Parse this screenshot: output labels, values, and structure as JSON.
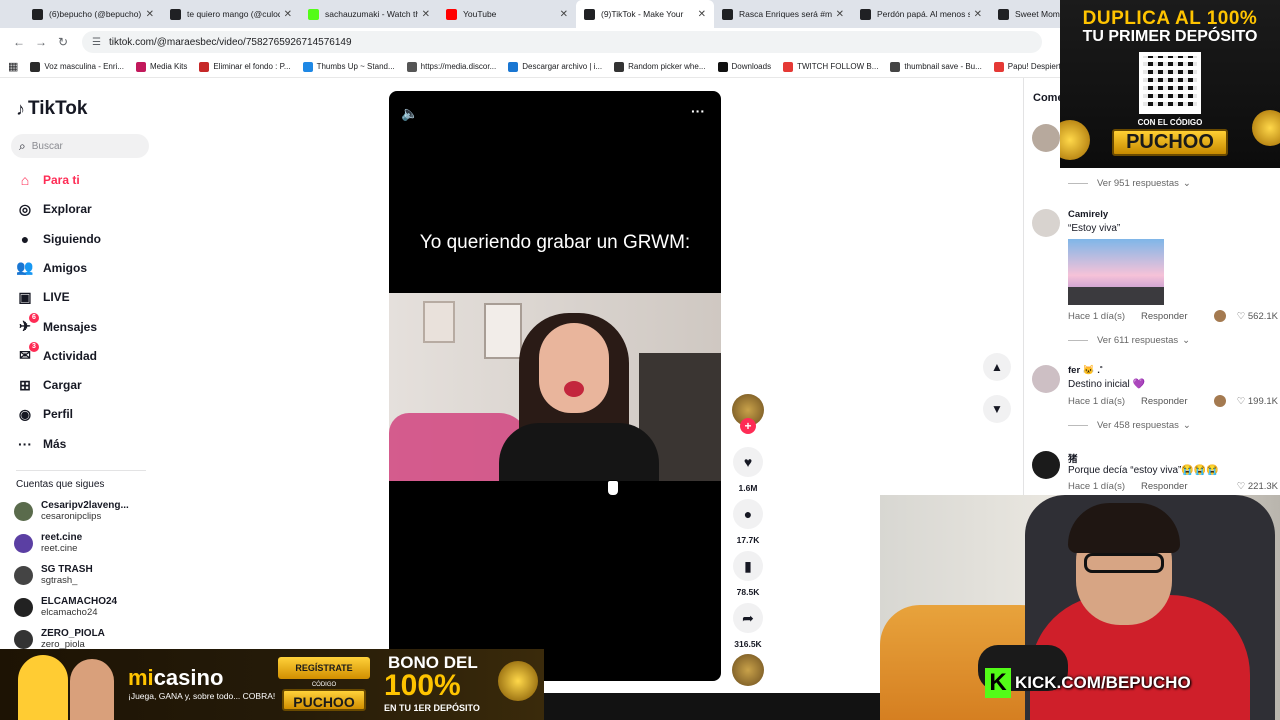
{
  "browser": {
    "tabs": [
      {
        "title": "(6)bepucho (@bepucho) |",
        "color": "#202124"
      },
      {
        "title": "te quiero mango (@culod",
        "color": "#202124"
      },
      {
        "title": "sachauzumaki - Watch th",
        "color": "#53fc18"
      },
      {
        "title": "YouTube",
        "color": "#ff0000"
      },
      {
        "title": "(9)TikTok - Make Your",
        "color": "#202124"
      },
      {
        "title": "Rasca Enriques será #me",
        "color": "#202124"
      },
      {
        "title": "Perdón papá. Al menos s",
        "color": "#202124"
      },
      {
        "title": "Sweet Mom",
        "color": "#202124"
      }
    ],
    "url": "tiktok.com/@maraesbec/video/7582765926714576149",
    "bookmarks": [
      {
        "label": "Voz masculina - Enri...",
        "color": "#2b2b2b"
      },
      {
        "label": "Media Kits",
        "color": "#c2185b"
      },
      {
        "label": "Eliminar el fondo : P...",
        "color": "#c62828"
      },
      {
        "label": "Thumbs Up ~ Stand...",
        "color": "#1e88e5"
      },
      {
        "label": "https://media.discor...",
        "color": "#555555"
      },
      {
        "label": "Descargar archivo | i...",
        "color": "#1976d2"
      },
      {
        "label": "Random picker whe...",
        "color": "#333333"
      },
      {
        "label": "Downloads",
        "color": "#111111"
      },
      {
        "label": "TWITCH FOLLOW B...",
        "color": "#e53935"
      },
      {
        "label": "thumbnail save - Bu...",
        "color": "#444444"
      },
      {
        "label": "Papu! Despierta",
        "color": "#e53935"
      }
    ]
  },
  "sidebar": {
    "logo": "TikTok",
    "search_placeholder": "Buscar",
    "nav": [
      {
        "label": "Para ti",
        "icon": "home-icon",
        "badge": ""
      },
      {
        "label": "Explorar",
        "icon": "compass-icon",
        "badge": ""
      },
      {
        "label": "Siguiendo",
        "icon": "following-avatar-icon",
        "badge": ""
      },
      {
        "label": "Amigos",
        "icon": "friends-icon",
        "badge": ""
      },
      {
        "label": "LIVE",
        "icon": "live-icon",
        "badge": ""
      },
      {
        "label": "Mensajes",
        "icon": "messages-icon",
        "badge": "6"
      },
      {
        "label": "Actividad",
        "icon": "activity-icon",
        "badge": "3"
      },
      {
        "label": "Cargar",
        "icon": "upload-icon",
        "badge": ""
      },
      {
        "label": "Perfil",
        "icon": "profile-icon",
        "badge": ""
      },
      {
        "label": "Más",
        "icon": "more-icon",
        "badge": ""
      }
    ],
    "following_title": "Cuentas que sigues",
    "following": [
      {
        "name": "Cesaripv2laveng...",
        "handle": "cesaronipclips"
      },
      {
        "name": "reet.cine",
        "handle": "reet.cine"
      },
      {
        "name": "SG TRASH",
        "handle": "sgtrash_"
      },
      {
        "name": "ELCAMACHO24",
        "handle": "elcamacho24"
      },
      {
        "name": "ZERO_PIOLA",
        "handle": "zero_piola"
      }
    ]
  },
  "video": {
    "caption": "Yo queriendo grabar un GRWM:",
    "likes": "1.6M",
    "comments": "17.7K",
    "saves": "78.5K",
    "shares": "316.5K"
  },
  "comments_panel": {
    "title": "Come",
    "view_replies_1": "Ver 951 respuestas",
    "items": [
      {
        "user": "Camirely",
        "text": "“Estoy viva”",
        "time": "Hace 1 día(s)",
        "reply": "Responder",
        "likes": "562.1K"
      },
      {
        "user": "fer 🐱 .˚",
        "text": "Destino inicial 💜",
        "time": "Hace 1 día(s)",
        "reply": "Responder",
        "likes": "199.1K"
      },
      {
        "user": "猪",
        "text": "Porque decía “estoy viva”😭😭😭",
        "time": "Hace 1 día(s)",
        "reply": "Responder",
        "likes": "221.3K"
      }
    ],
    "view_replies_2": "Ver 611 respuestas",
    "view_replies_3": "Ver 458 respuestas"
  },
  "ads": {
    "top_line1": "DUPLICA AL 100%",
    "top_line2": "TU PRIMER DEPÓSITO",
    "top_code_label": "CON EL CÓDIGO",
    "top_code": "PUCHOO",
    "bottom_brand_prefix": "mi",
    "bottom_brand": "casino",
    "bottom_tagline": "¡Juega, GANA y, sobre todo... COBRA!",
    "bottom_register": "REGÍSTRATE",
    "bottom_code_label": "CÓDIGO",
    "bottom_code": "PUCHOO",
    "bottom_bono": "BONO DEL",
    "bottom_pct": "100%",
    "bottom_dep": "EN TU 1ER DEPÓSITO"
  },
  "stream": {
    "kick_text": "KICK.COM/BEPUCHO"
  }
}
